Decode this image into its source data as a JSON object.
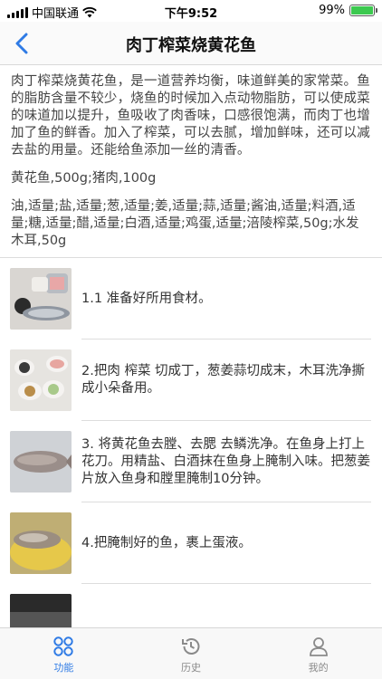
{
  "status_bar": {
    "carrier": "中国联通",
    "time": "下午9:52",
    "battery_percent": "99%",
    "battery_level": 0.99
  },
  "nav": {
    "title": "肉丁榨菜烧黄花鱼"
  },
  "recipe": {
    "intro": "肉丁榨菜烧黄花鱼，是一道营养均衡，味道鲜美的家常菜。鱼的脂肪含量不较少，烧鱼的时候加入点动物脂肪，可以使成菜的味道加以提升，鱼吸收了肉香味，口感很饱满，而肉丁也增加了鱼的鲜香。加入了榨菜，可以去腻，增加鲜味，还可以减去盐的用量。还能给鱼添加一丝的清香。",
    "main_ingredients": "黄花鱼,500g;猪肉,100g",
    "aux_ingredients": "油,适量;盐,适量;葱,适量;姜,适量;蒜,适量;酱油,适量;料酒,适量;糖,适量;醋,适量;白酒,适量;鸡蛋,适量;涪陵榨菜,50g;水发木耳,50g"
  },
  "steps": [
    {
      "text": "1.1 准备好所用食材。"
    },
    {
      "text": "2.把肉 榨菜 切成丁，葱姜蒜切成末，木耳洗净撕成小朵备用。"
    },
    {
      "text": "3. 将黄花鱼去膛、去腮 去鳞洗净。在鱼身上打上花刀。用精盐、白酒抹在鱼身上腌制入味。把葱姜片放入鱼身和膛里腌制10分钟。"
    },
    {
      "text": "4.把腌制好的鱼，裹上蛋液。"
    },
    {
      "text": ""
    }
  ],
  "tabs": [
    {
      "label": "功能",
      "icon": "grid-icon",
      "active": true
    },
    {
      "label": "历史",
      "icon": "history-icon",
      "active": false
    },
    {
      "label": "我的",
      "icon": "profile-icon",
      "active": false
    }
  ],
  "colors": {
    "accent": "#2f7be5",
    "battery": "#3cc94f",
    "tab_inactive": "#8a8a8a"
  }
}
